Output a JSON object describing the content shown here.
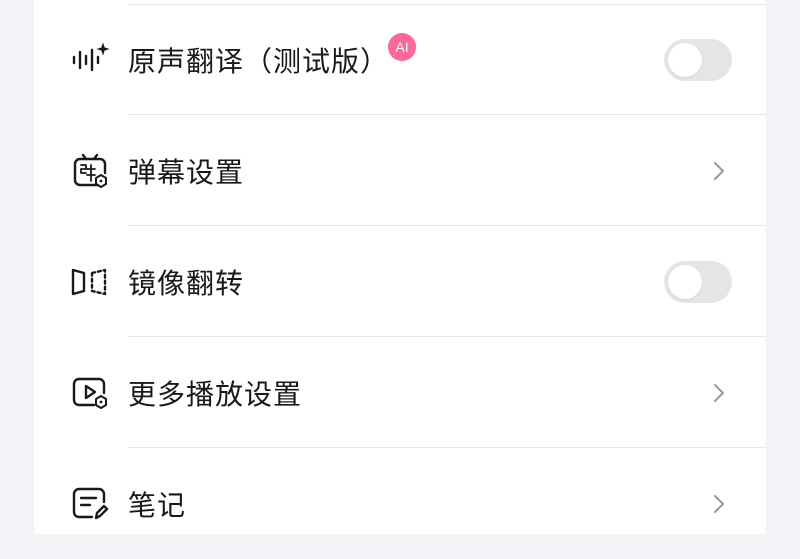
{
  "settings": {
    "items": [
      {
        "label": "原声翻译（测试版）",
        "badge": "AI",
        "control": "toggle",
        "toggle_on": false,
        "icon": "voice-translate-icon"
      },
      {
        "label": "弹幕设置",
        "control": "chevron",
        "icon": "danmaku-icon"
      },
      {
        "label": "镜像翻转",
        "control": "toggle",
        "toggle_on": false,
        "icon": "mirror-flip-icon"
      },
      {
        "label": "更多播放设置",
        "control": "chevron",
        "icon": "play-settings-icon"
      },
      {
        "label": "笔记",
        "control": "chevron",
        "icon": "note-icon"
      }
    ]
  },
  "colors": {
    "background": "#f2f3f6",
    "panel": "#ffffff",
    "text": "#18191c",
    "badge": "#ff6699",
    "toggle_off": "#e3e5e7",
    "divider": "#e5e6ea"
  }
}
